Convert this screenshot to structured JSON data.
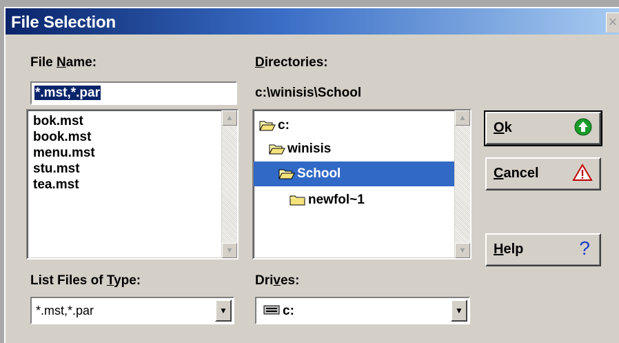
{
  "window": {
    "title": "File Selection",
    "close_glyph": "×"
  },
  "file_name": {
    "label_prefix": "File ",
    "label_hotkey": "N",
    "label_rest": "ame:",
    "value": "*.mst,*.par",
    "files": [
      "bok.mst",
      "book.mst",
      "menu.mst",
      "stu.mst",
      "tea.mst"
    ]
  },
  "directories": {
    "label_hotkey": "D",
    "label_rest": "irectories:",
    "current_path": "c:\\winisis\\School",
    "tree": [
      {
        "name": "c:",
        "icon": "open-folder-icon",
        "selected": false
      },
      {
        "name": "winisis",
        "icon": "open-folder-icon",
        "selected": false
      },
      {
        "name": "School",
        "icon": "open-folder-icon",
        "selected": true
      },
      {
        "name": "newfol~1",
        "icon": "closed-folder-icon",
        "selected": false
      }
    ],
    "selected_color": "#3169c6"
  },
  "buttons": {
    "ok": {
      "hotkey": "O",
      "rest": "k",
      "icon": "green-up-arrow-icon"
    },
    "cancel": {
      "hotkey": "C",
      "rest": "ancel",
      "icon": "warning-triangle-icon"
    },
    "help": {
      "hotkey": "H",
      "rest": "elp",
      "icon": "question-mark-icon",
      "glyph": "?"
    }
  },
  "file_type": {
    "label_prefix": "List Files of ",
    "label_hotkey": "T",
    "label_rest": "ype:",
    "value": "*.mst,*.par"
  },
  "drives": {
    "label_prefix": "Dri",
    "label_hotkey": "v",
    "label_rest": "es:",
    "value": "c:",
    "icon": "drive-icon"
  }
}
